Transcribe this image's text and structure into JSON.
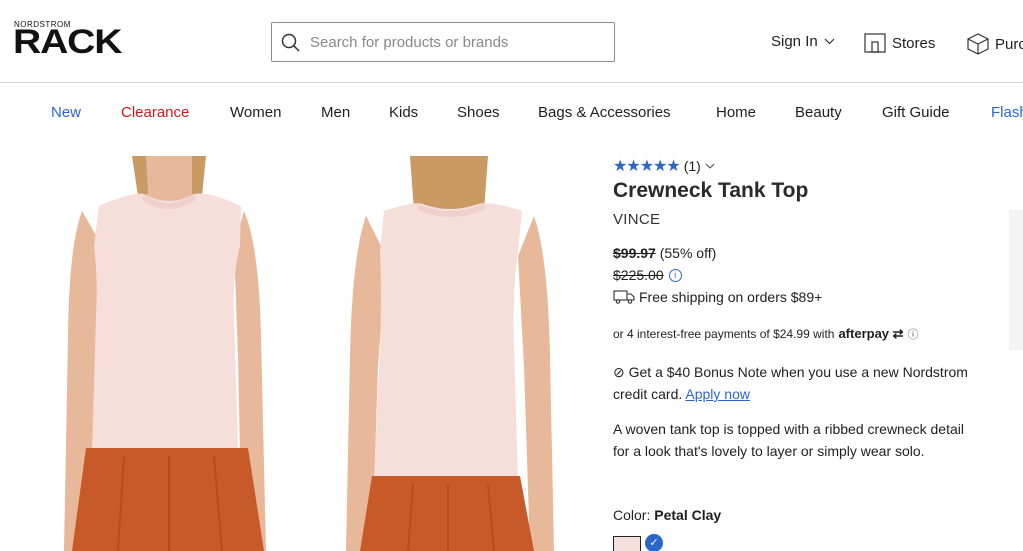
{
  "header": {
    "logo_small": "NORDSTROM",
    "logo_big": "RACK",
    "search_placeholder": "Search for products or brands",
    "sign_in": "Sign In",
    "stores": "Stores",
    "purchases": "Purc"
  },
  "nav": {
    "items": [
      {
        "label": "New",
        "color": "#2b67c9"
      },
      {
        "label": "Clearance",
        "color": "#d0191e"
      },
      {
        "label": "Women",
        "color": "#1f1f1f"
      },
      {
        "label": "Men",
        "color": "#1f1f1f"
      },
      {
        "label": "Kids",
        "color": "#1f1f1f"
      },
      {
        "label": "Shoes",
        "color": "#1f1f1f"
      },
      {
        "label": "Bags & Accessories",
        "color": "#1f1f1f"
      },
      {
        "label": "Home",
        "color": "#1f1f1f"
      },
      {
        "label": "Beauty",
        "color": "#1f1f1f"
      },
      {
        "label": "Gift Guide",
        "color": "#1f1f1f"
      },
      {
        "label": "Flash",
        "color": "#2b67c9"
      }
    ]
  },
  "product": {
    "rating_count": "(1)",
    "title": "Crewneck Tank Top",
    "brand": "VINCE",
    "price": "$99.97",
    "discount": "(55% off)",
    "original_price": "$225.00",
    "shipping": "Free shipping on orders $89+",
    "afterpay_text": "or 4 interest-free payments of $24.99 with",
    "afterpay_brand": "afterpay",
    "bonus_text": "Get a $40 Bonus Note when you use a new Nordstrom credit card.",
    "apply_now": "Apply now",
    "description": "A woven tank top is topped with a ribbed crewneck detail for a look that's lovely to layer or simply wear solo.",
    "color_label": "Color:",
    "color_value": "Petal Clay"
  },
  "colors": {
    "accent": "#2b67c9",
    "clearance": "#d0191e",
    "top_fabric": "#f6dedb",
    "skirt": "#c85a2a",
    "skin": "#e8b89a",
    "hair": "#c99a64"
  }
}
